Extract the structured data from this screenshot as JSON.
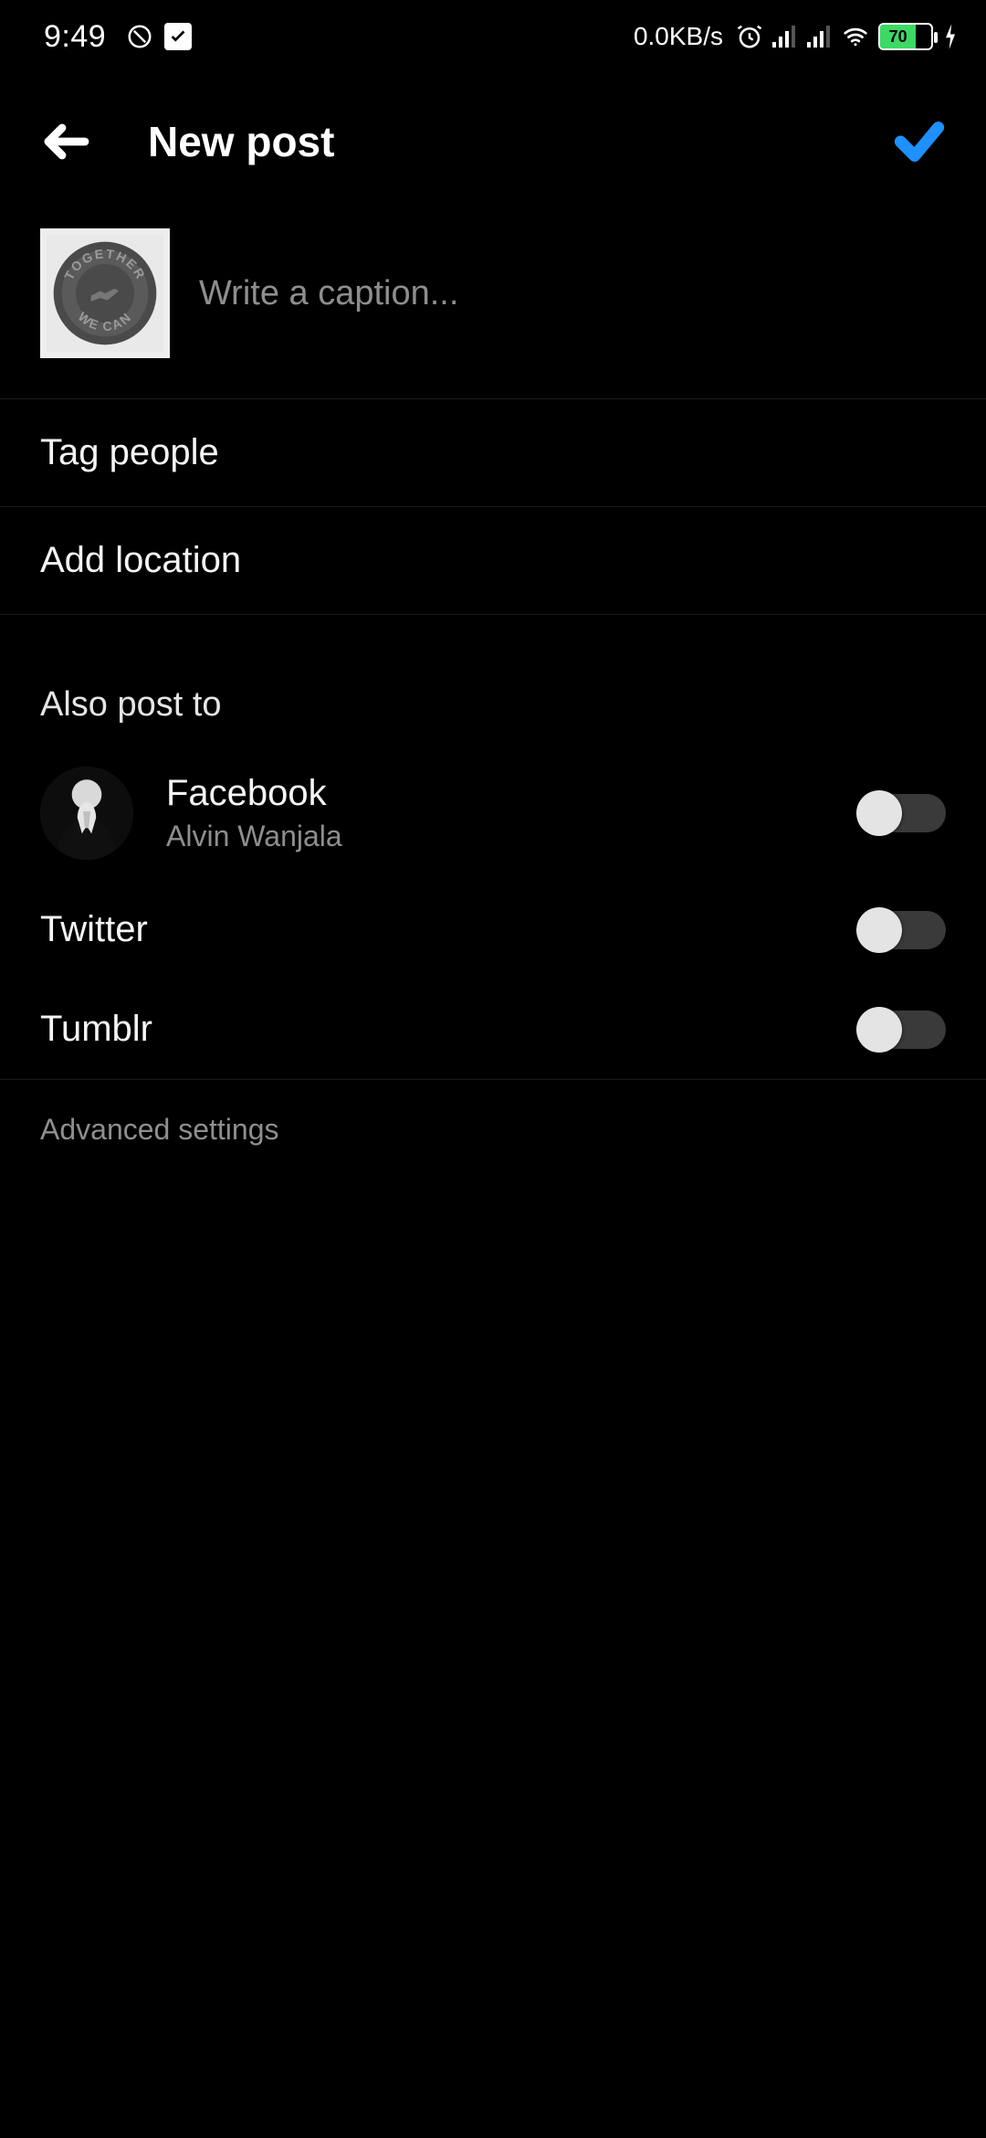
{
  "status": {
    "time": "9:49",
    "net_speed": "0.0KB/s",
    "battery_pct": "70"
  },
  "header": {
    "title": "New post"
  },
  "caption": {
    "placeholder": "Write a caption..."
  },
  "rows": {
    "tag_people": "Tag people",
    "add_location": "Add location"
  },
  "share": {
    "section_title": "Also post to",
    "items": [
      {
        "title": "Facebook",
        "subtitle": "Alvin Wanjala",
        "has_avatar": true,
        "on": false
      },
      {
        "title": "Twitter",
        "subtitle": "",
        "has_avatar": false,
        "on": false
      },
      {
        "title": "Tumblr",
        "subtitle": "",
        "has_avatar": false,
        "on": false
      }
    ]
  },
  "advanced": {
    "label": "Advanced settings"
  }
}
